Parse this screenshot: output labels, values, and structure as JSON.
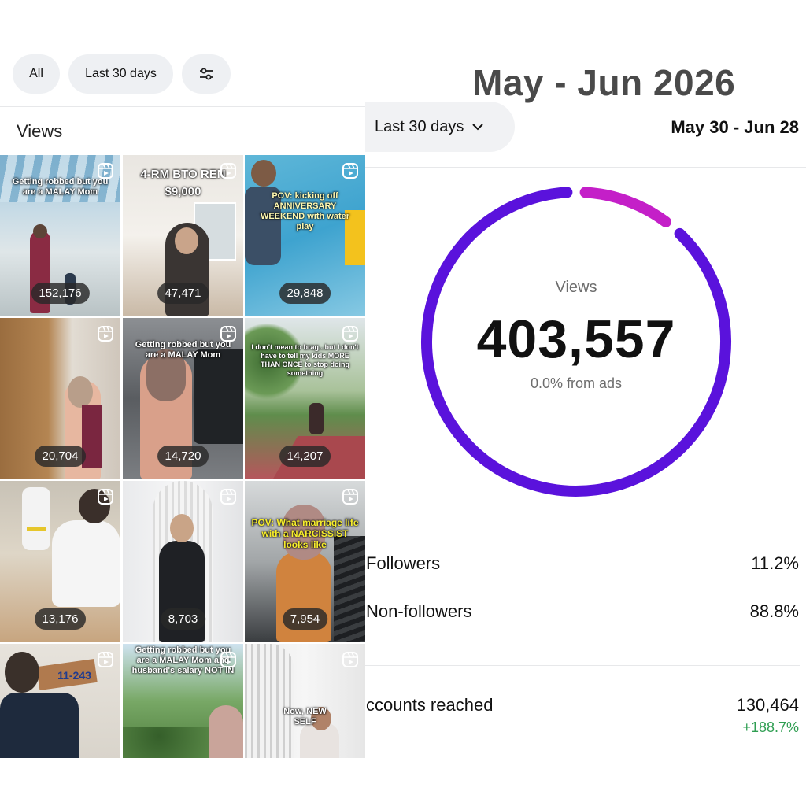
{
  "filters": {
    "all": "All",
    "range": "Last 30 days"
  },
  "section_title": "Views",
  "header": {
    "title": "May - Jun 2026",
    "range_dropdown": "Last 30 days",
    "date_range": "May 30 - Jun 28"
  },
  "reels": [
    {
      "views": "152,176",
      "caption": "Getting robbed but you are a MALAY Mom"
    },
    {
      "views": "47,471",
      "caption": "4-RM BTO REN $9,000"
    },
    {
      "views": "29,848",
      "caption": "POV: kicking off ANNIVERSARY WEEKEND with water play"
    },
    {
      "views": "20,704",
      "caption": ""
    },
    {
      "views": "14,720",
      "caption": "Getting robbed but you are a MALAY Mom"
    },
    {
      "views": "14,207",
      "caption": "I don't mean to brag...but I don't have to tell my kids MORE THAN ONCE to stop doing something"
    },
    {
      "views": "13,176",
      "caption": ""
    },
    {
      "views": "8,703",
      "caption": ""
    },
    {
      "views": "7,954",
      "caption": "POV: What marriage life with a NARCISSIST looks like"
    },
    {
      "views": "",
      "caption": "11-243"
    },
    {
      "views": "",
      "caption": "Getting robbed but you are a MALAY Mom and husband's salary NOT IN"
    },
    {
      "views": "",
      "caption": "Now, NEW SELF"
    }
  ],
  "views_summary": {
    "label": "Views",
    "total": "403,557",
    "ads_note": "0.0% from ads"
  },
  "audience": [
    {
      "label": "Followers",
      "percent": "11.2%",
      "fraction": 0.112
    },
    {
      "label": "Non-followers",
      "percent": "88.8%",
      "fraction": 0.888
    }
  ],
  "accounts_reached": {
    "label": "ccounts reached",
    "value": "130,464",
    "change": "+188.7%"
  },
  "colors": {
    "non_followers": "#5a12dc",
    "followers": "#c41fc8",
    "growth": "#2f9e52",
    "chip_bg": "#eef0f3"
  }
}
